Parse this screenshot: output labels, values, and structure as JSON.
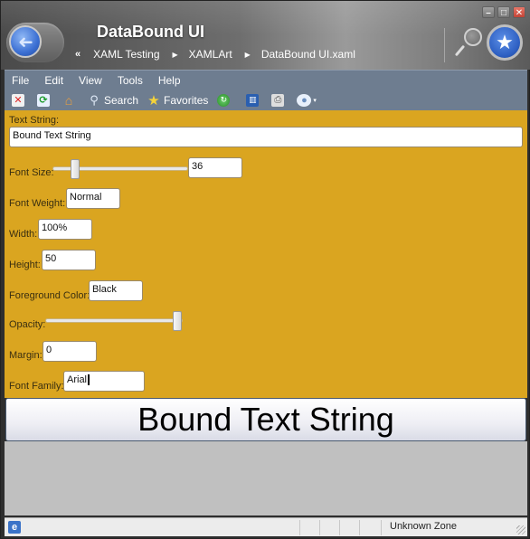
{
  "window": {
    "title": "DataBound UI",
    "breadcrumb": {
      "overflow_glyph": "«",
      "items": [
        "XAML Testing",
        "XAMLArt",
        "DataBound UI.xaml"
      ],
      "separator_glyph": "▶"
    },
    "controls": {
      "minimize": "–",
      "maximize": "□",
      "close": "✕"
    },
    "back_icon": "➜",
    "favorites_icon": "★"
  },
  "menu": {
    "items": [
      "File",
      "Edit",
      "View",
      "Tools",
      "Help"
    ]
  },
  "toolbar": {
    "items": [
      {
        "name": "stop",
        "icon": "stop-icon",
        "glyph": "✕",
        "label": ""
      },
      {
        "name": "refresh",
        "icon": "refresh-icon",
        "glyph": "⟳",
        "label": ""
      },
      {
        "name": "home",
        "icon": "home-icon",
        "glyph": "⌂",
        "label": ""
      },
      {
        "name": "search",
        "icon": "search-icon",
        "glyph": "🔍",
        "label": "Search"
      },
      {
        "name": "favorites",
        "icon": "star-icon",
        "glyph": "★",
        "label": "Favorites"
      },
      {
        "name": "feeds",
        "icon": "feeds-icon",
        "glyph": "↻",
        "label": ""
      },
      {
        "name": "research",
        "icon": "research-icon",
        "glyph": "▥",
        "label": ""
      },
      {
        "name": "print",
        "icon": "print-icon",
        "glyph": "⎙",
        "label": ""
      },
      {
        "name": "messenger",
        "icon": "messenger-icon",
        "glyph": "●",
        "label": ""
      }
    ],
    "dropdown_glyph": "▾"
  },
  "form": {
    "text_string": {
      "label": "Text String:",
      "value": "Bound Text String"
    },
    "font_size": {
      "label": "Font Size:",
      "value": "36",
      "slider_fraction": 0.14
    },
    "font_weight": {
      "label": "Font Weight:",
      "value": "Normal"
    },
    "width": {
      "label": "Width:",
      "value": "100%"
    },
    "height": {
      "label": "Height:",
      "value": "50"
    },
    "foreground_color": {
      "label": "Foreground Color:",
      "value": "Black"
    },
    "opacity": {
      "label": "Opacity:",
      "slider_fraction": 1.0
    },
    "margin": {
      "label": "Margin:",
      "value": "0"
    },
    "font_family": {
      "label": "Font Family:",
      "value": "Arial"
    }
  },
  "preview": {
    "text": "Bound Text String"
  },
  "colors": {
    "content_bg": "#daa520",
    "toolbar_bg": "#6e7d90",
    "blank_bg": "#c0c0c0"
  },
  "statusbar": {
    "zone": "Unknown Zone",
    "ie_icon": "e"
  }
}
